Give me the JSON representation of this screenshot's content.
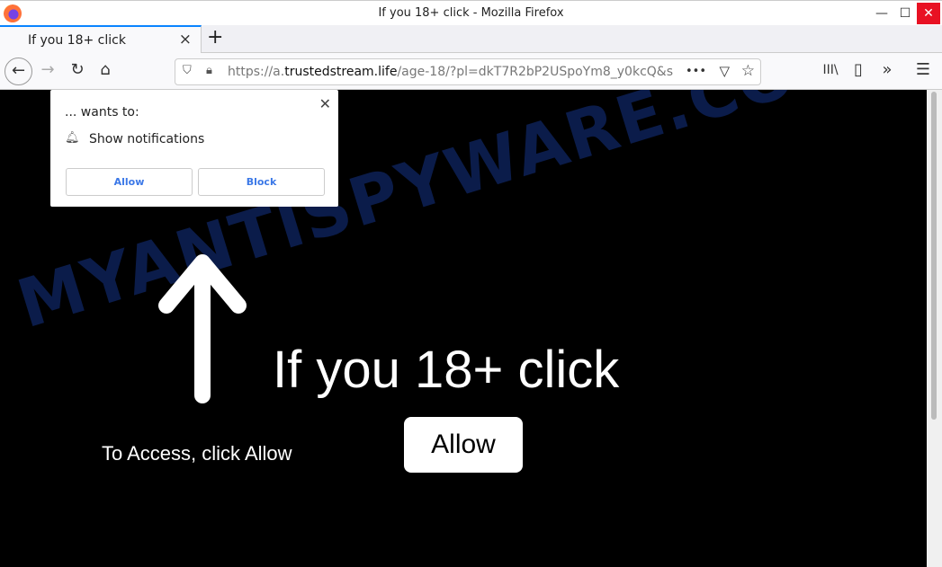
{
  "window": {
    "title": "If you 18+ click - Mozilla Firefox",
    "minimize": "—",
    "maximize": "☐",
    "close": "✕"
  },
  "tab": {
    "title": "If you 18+ click",
    "close": "×",
    "new_tab": "+"
  },
  "nav": {
    "back": "←",
    "forward": "→",
    "reload": "↻",
    "home": "⌂",
    "url_prefix": "https://a.",
    "url_domain": "trustedstream.life",
    "url_path": "/age-18/?pl=dkT7R2bP2USpoYm8_y0kcQ&s",
    "more": "•••",
    "pocket": "▽",
    "star": "☆",
    "library": "III\\",
    "sidebar": "▯",
    "overflow": "»",
    "menu": "☰"
  },
  "popup": {
    "wants": "... wants to:",
    "permission": "Show notifications",
    "allow": "Allow",
    "block": "Block",
    "close": "✕"
  },
  "page": {
    "headline": "If you 18+ click",
    "access": "To Access, click Allow",
    "allow": "Allow",
    "watermark": "MYANTISPYWARE.COM"
  }
}
